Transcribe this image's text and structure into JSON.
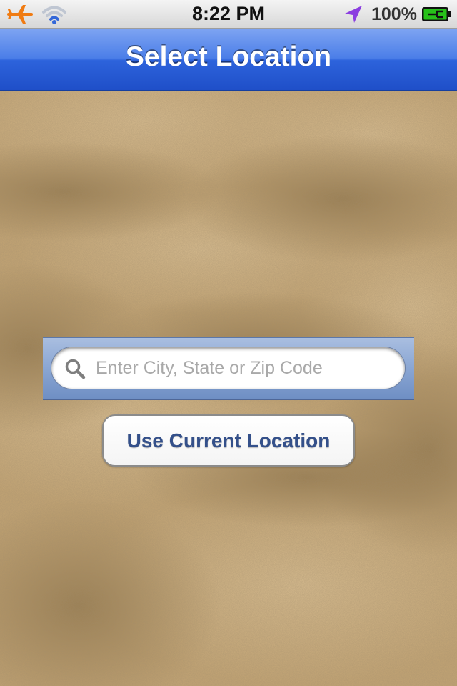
{
  "status_bar": {
    "time": "8:22 PM",
    "battery_percent": "100%",
    "icons": [
      "airplane-icon",
      "wifi-icon",
      "location-arrow-icon",
      "battery-charging-icon"
    ]
  },
  "nav_bar": {
    "title": "Select Location"
  },
  "search": {
    "placeholder": "Enter City, State or Zip Code",
    "value": ""
  },
  "current_location_button": {
    "label": "Use Current Location"
  },
  "colors": {
    "nav_bar": "#2d63dc",
    "search_bar_tint": "#8aa6d3",
    "button_text": "#34508a",
    "airplane_icon": "#f07b12",
    "wifi_icon": "#3468d8",
    "location_arrow": "#8b3ee0",
    "battery_fill": "#27c21a"
  }
}
